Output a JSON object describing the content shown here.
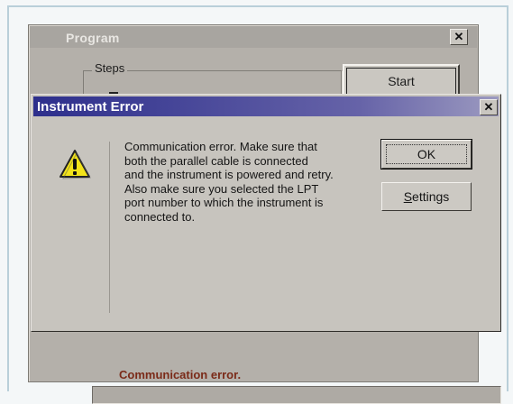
{
  "program_window": {
    "title": "Program",
    "close_glyph": "✕",
    "steps_label": "Steps",
    "start_label": "Start",
    "status_text": "Communication error."
  },
  "dialog": {
    "title": "Instrument Error",
    "close_glyph": "✕",
    "icon": "warning-icon",
    "message_lines": [
      "Communication error. Make sure that",
      "both the parallel cable is connected",
      "and the instrument is powered and retry.",
      "Also make sure you selected the LPT",
      "port number to which the instrument is",
      "connected to."
    ],
    "ok_label": "OK",
    "settings_label_first": "S",
    "settings_label_rest": "ettings"
  },
  "colors": {
    "title_bar_start": "#2d2f8c",
    "title_bar_end": "#9c9ac0",
    "status_text": "#7a2a18",
    "warning_yellow": "#f2e31a"
  }
}
